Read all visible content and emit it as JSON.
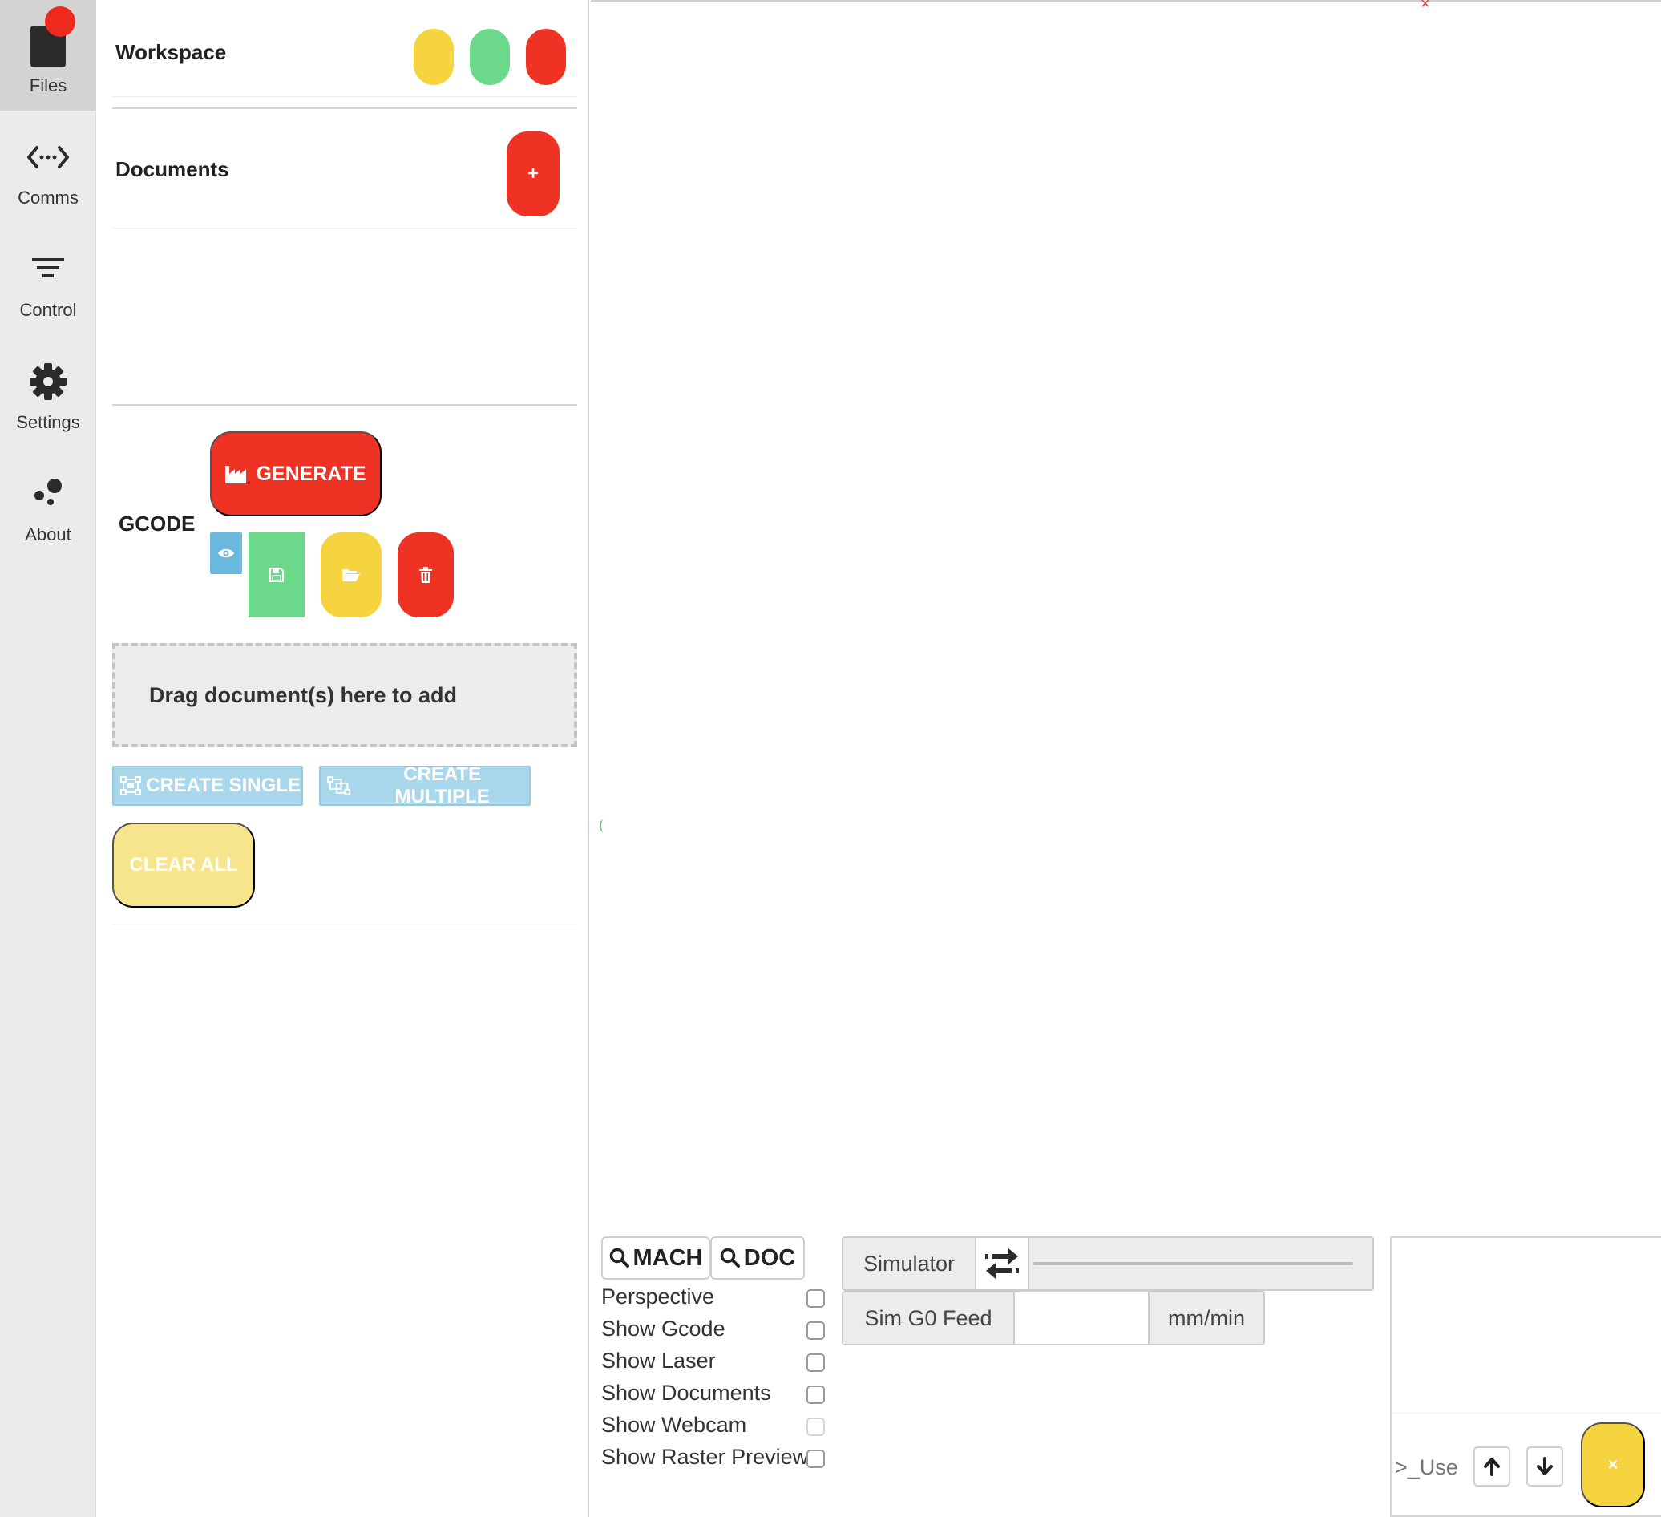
{
  "sidebar": {
    "items": [
      {
        "label": "Files",
        "icon": "file-icon",
        "active": true,
        "badge_color": "#ee2a1e"
      },
      {
        "label": "Comms",
        "icon": "code-arrows-icon"
      },
      {
        "label": "Control",
        "icon": "filter-lines-icon"
      },
      {
        "label": "Settings",
        "icon": "gear-icon"
      },
      {
        "label": "About",
        "icon": "dots-cluster-icon"
      }
    ]
  },
  "workspace": {
    "title": "Workspace",
    "buttons": [
      {
        "name": "workspace-yellow-button",
        "color": "#f5d43f"
      },
      {
        "name": "workspace-green-button",
        "color": "#6cd98a"
      },
      {
        "name": "workspace-red-button",
        "color": "#ee3224"
      }
    ]
  },
  "documents": {
    "title": "Documents",
    "add_label": "+"
  },
  "gcode": {
    "title": "GCODE",
    "generate_label": "GENERATE",
    "icons": [
      "factory-icon",
      "eye-icon",
      "save-icon",
      "folder-open-icon",
      "trash-icon"
    ]
  },
  "dropzone": {
    "text": "Drag document(s) here to add"
  },
  "actions": {
    "create_single": "CREATE SINGLE",
    "create_multiple": "CREATE MULTIPLE",
    "clear_all": "CLEAR ALL"
  },
  "view": {
    "mach_label": "MACH",
    "doc_label": "DOC",
    "options": [
      {
        "label": "Perspective",
        "checked": false
      },
      {
        "label": "Show Gcode",
        "checked": false
      },
      {
        "label": "Show Laser",
        "checked": false
      },
      {
        "label": "Show Documents",
        "checked": false
      },
      {
        "label": "Show Webcam",
        "checked": false,
        "disabled": true
      },
      {
        "label": "Show Raster Preview",
        "checked": false
      }
    ]
  },
  "simulator": {
    "label": "Simulator",
    "feed_label": "Sim G0 Feed",
    "feed_value": "",
    "feed_unit": "mm/min"
  },
  "console": {
    "placeholder": ">_Use l",
    "clear_label": "×"
  },
  "colors": {
    "accent_red": "#ee3224",
    "accent_green": "#6cd98a",
    "accent_yellow": "#f5d43f",
    "accent_blue": "#6ab8de"
  }
}
